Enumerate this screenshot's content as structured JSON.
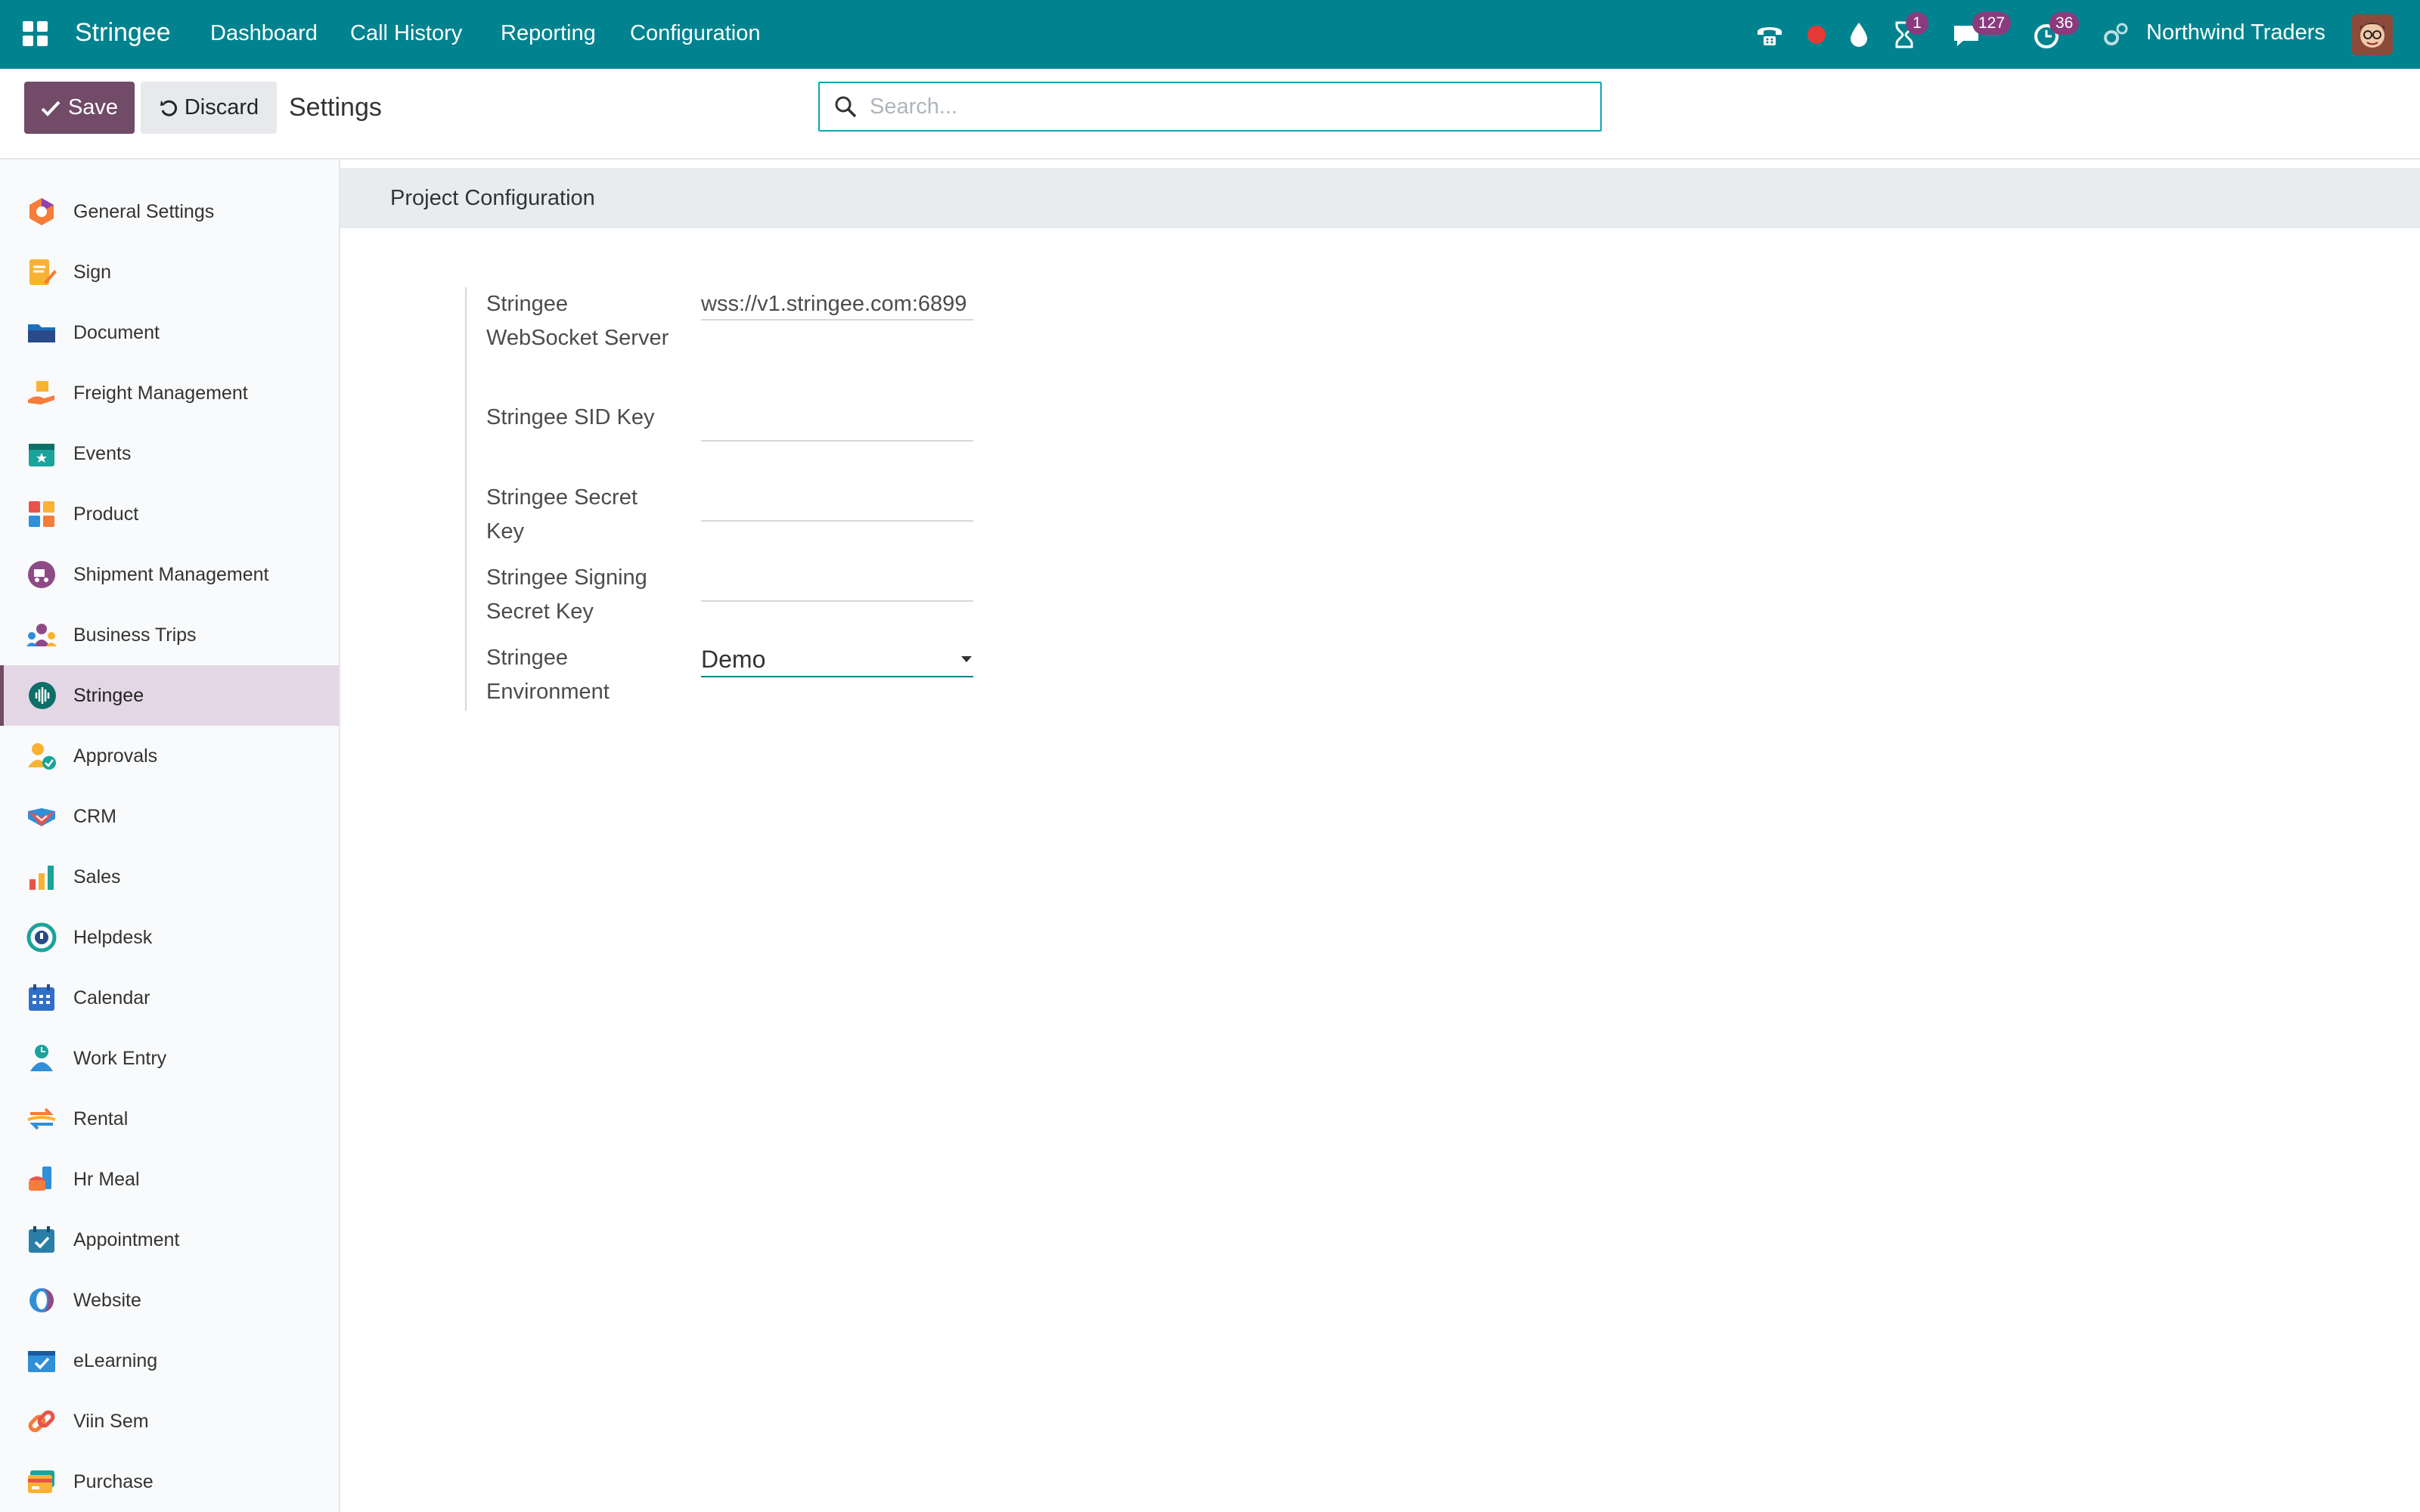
{
  "navbar": {
    "brand": "Stringee",
    "menu": [
      {
        "label": "Dashboard"
      },
      {
        "label": "Call History"
      },
      {
        "label": "Reporting"
      },
      {
        "label": "Configuration"
      }
    ],
    "badges": {
      "activities": "1",
      "messages": "127",
      "clock": "36"
    },
    "company": "Northwind Traders",
    "colors": {
      "navbar_bg": "#00838f",
      "badge_bg": "#8a3b7e",
      "record_dot": "#e53935"
    }
  },
  "control_panel": {
    "save_label": "Save",
    "discard_label": "Discard",
    "title": "Settings",
    "search_placeholder": "Search...",
    "colors": {
      "save_bg": "#714b67",
      "search_border": "#17a2b8"
    }
  },
  "sidebar": {
    "items": [
      {
        "label": "General Settings"
      },
      {
        "label": "Sign"
      },
      {
        "label": "Document"
      },
      {
        "label": "Freight Management"
      },
      {
        "label": "Events"
      },
      {
        "label": "Product"
      },
      {
        "label": "Shipment Management"
      },
      {
        "label": "Business Trips"
      },
      {
        "label": "Stringee",
        "active": true
      },
      {
        "label": "Approvals"
      },
      {
        "label": "CRM"
      },
      {
        "label": "Sales"
      },
      {
        "label": "Helpdesk"
      },
      {
        "label": "Calendar"
      },
      {
        "label": "Work Entry"
      },
      {
        "label": "Rental"
      },
      {
        "label": "Hr Meal"
      },
      {
        "label": "Appointment"
      },
      {
        "label": "Website"
      },
      {
        "label": "eLearning"
      },
      {
        "label": "Viin Sem"
      },
      {
        "label": "Purchase"
      }
    ]
  },
  "content": {
    "section_title": "Project Configuration",
    "fields": {
      "websocket": {
        "label": "Stringee WebSocket Server",
        "value": "wss://v1.stringee.com:6899"
      },
      "sid": {
        "label": "Stringee SID Key",
        "value": ""
      },
      "secret": {
        "label": "Stringee Secret Key",
        "value": ""
      },
      "signing": {
        "label": "Stringee Signing Secret Key",
        "value": ""
      },
      "environment": {
        "label": "Stringee Environment",
        "value": "Demo"
      }
    }
  }
}
